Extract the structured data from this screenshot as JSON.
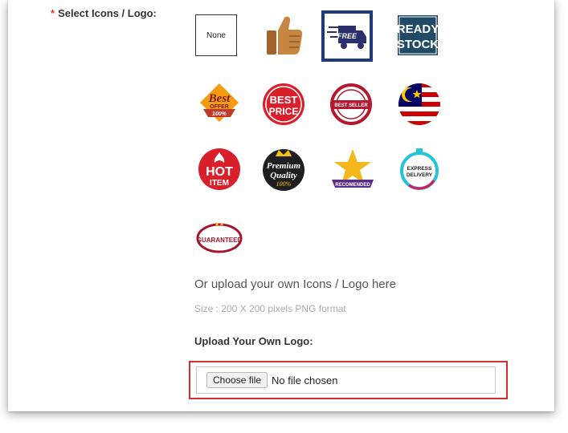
{
  "form": {
    "required_mark": "*",
    "select_label": "Select Icons / Logo:",
    "upload_text": "Or upload your own Icons / Logo here",
    "size_text": "Size : 200 X 200 pixels PNG format",
    "upload_label": "Upload Your Own Logo:",
    "file_button": "Choose file",
    "file_status": "No file chosen"
  },
  "icons": {
    "none": "None",
    "free": "FREE",
    "ready_1": "READY",
    "ready_2": "STOCK",
    "best_1": "Best",
    "best_2": "OFFER",
    "best_3": "100%",
    "bestprice_1": "BEST",
    "bestprice_2": "PRICE",
    "bestseller": "BEST SELLER",
    "hot_1": "HOT",
    "hot_2": "ITEM",
    "premium_1": "Premium",
    "premium_2": "Quality",
    "premium_3": "100%",
    "recommended": "RECOMENDED",
    "express_1": "EXPRESS",
    "express_2": "DELIVERY",
    "guaranteed": "GUARANTEED"
  },
  "colors": {
    "selected_border": "#1e3a7a",
    "highlight": "#d32f2f",
    "required": "#e53935"
  }
}
